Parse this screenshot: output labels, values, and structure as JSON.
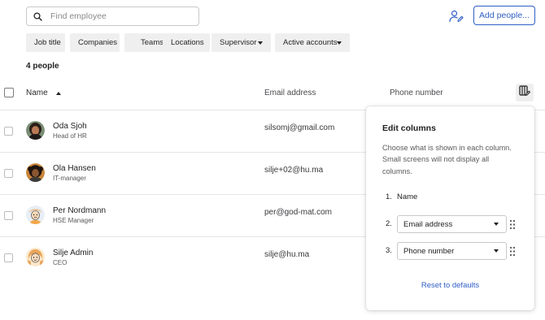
{
  "search": {
    "placeholder": "Find employee",
    "value": ""
  },
  "header": {
    "add_button_label": "Add people...",
    "user_edit_icon": "user-edit-icon"
  },
  "filters": [
    {
      "label": "Job title",
      "has_dropdown": false
    },
    {
      "label": "Companies",
      "has_dropdown": false
    },
    {
      "label": "Teams",
      "has_dropdown": false
    },
    {
      "label": "Locations",
      "has_dropdown": false
    },
    {
      "label": "Supervisor",
      "has_dropdown": true
    },
    {
      "label": "Active accounts",
      "has_dropdown": true
    }
  ],
  "people_count": "4 people",
  "table": {
    "columns": {
      "name": "Name",
      "email": "Email address",
      "phone": "Phone number"
    },
    "sort": {
      "column": "name",
      "direction": "ascending"
    },
    "rows": [
      {
        "name": "Oda Sjoh",
        "role": "Head of HR",
        "email": "silsomj@gmail.com"
      },
      {
        "name": "Ola Hansen",
        "role": "IT-manager",
        "email": "silje+02@hu.ma"
      },
      {
        "name": "Per Nordmann",
        "role": "HSE Manager",
        "email": "per@god-mat.com"
      },
      {
        "name": "Silje Admin",
        "role": "CEO",
        "email": "silje@hu.ma"
      }
    ]
  },
  "edit_columns": {
    "title": "Edit columns",
    "description": "Choose what is shown in each column. Small screens will not display all columns.",
    "items": [
      {
        "number": "1.",
        "value": "Name"
      },
      {
        "number": "2.",
        "value": "Email address"
      },
      {
        "number": "3.",
        "value": "Phone number"
      }
    ],
    "reset_label": "Reset to defaults"
  },
  "colors": {
    "accent": "#2f5ec4",
    "chip_bg": "#efefef",
    "border": "#c9c9cc"
  }
}
